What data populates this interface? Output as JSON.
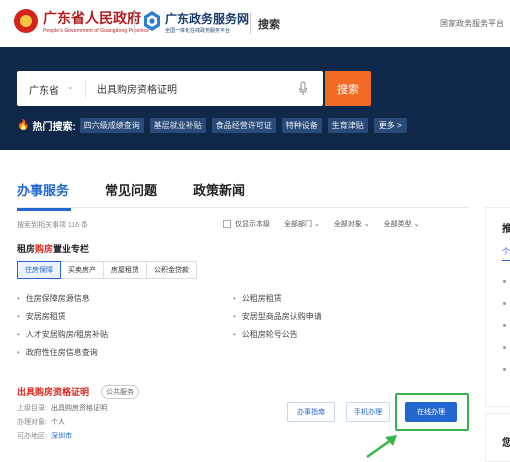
{
  "header": {
    "gov_title": "广东省人民政府",
    "gov_subtitle": "People's Government of Guangdong Province",
    "service_title": "广东政务服务网",
    "service_subtitle": "全国一体化在线政务服务平台",
    "search_label": "搜索",
    "platform_link": "国家政务服务平台"
  },
  "search": {
    "region": "广东省",
    "query": "出具购房资格证明",
    "button": "搜索",
    "hot_label": "热门搜索:",
    "hot_items": [
      "四六级成绩查询",
      "基层就业补贴",
      "食品经营许可证",
      "特种设备",
      "生育津贴"
    ],
    "more": "更多 >"
  },
  "tabs": [
    "办事服务",
    "常见问题",
    "政策新闻"
  ],
  "results": {
    "count_text": "搜索到相关事项 116 条",
    "filters": {
      "checkbox_label": "仅显示本级",
      "dept": "全部部门",
      "target": "全部对象",
      "type": "全部类型"
    },
    "zone": {
      "title_prefix": "租房",
      "title_highlight": "购房",
      "title_suffix": "置业专栏",
      "subtabs": [
        "住房保障",
        "买卖房产",
        "房屋租赁",
        "公积金贷款"
      ],
      "links": [
        "住房保障房源信息",
        "公租房租赁",
        "安居房租赁",
        "安居型商品房认购申请",
        "人才安居购房/租房补贴",
        "公租房轮号公告",
        "政府性住房信息查询"
      ]
    },
    "item": {
      "title": "出具购房资格证明",
      "badge": "公共服务",
      "catalog_label": "上级目录:",
      "catalog_value": "出具购房资格证明",
      "target_label": "办理对象:",
      "target_value": "个人",
      "region_label": "可办地区:",
      "region_value": "深圳市",
      "guide_button": "办事指南",
      "mobile_button": "手机办理",
      "online_button": "在线办理"
    }
  },
  "right_panel": {
    "char1": "推",
    "tab1": "个",
    "char2": "您"
  },
  "colors": {
    "brand_red": "#d9261c",
    "nav_blue": "#0f2748",
    "accent_orange": "#f06a24",
    "link_blue": "#2466d0",
    "highlight_green": "#38b449"
  }
}
